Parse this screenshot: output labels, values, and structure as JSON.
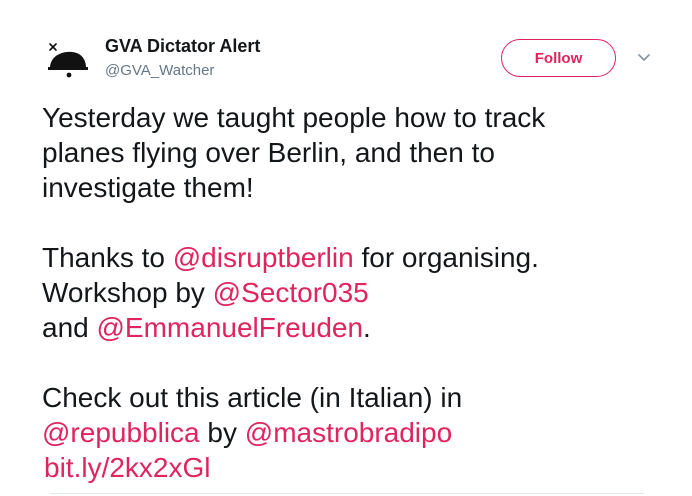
{
  "user": {
    "name": "GVA Dictator Alert",
    "handle": "@GVA_Watcher",
    "avatar_icon": "dictator-plane-avatar-icon"
  },
  "actions": {
    "follow_label": "Follow",
    "more_icon": "chevron-down-icon"
  },
  "colors": {
    "accent": "#e0245e",
    "text": "#14171a",
    "muted": "#657786"
  },
  "tweet": {
    "line1": "Yesterday we taught people how to track",
    "line2": "planes flying over Berlin, and then to",
    "line3": "investigate them!",
    "thanks_prefix": "Thanks to ",
    "mention_disrupt": "@disruptberlin",
    "thanks_suffix": " for organising.",
    "workshop_prefix": "Workshop by ",
    "mention_sector": "@Sector035",
    "and_prefix": "and ",
    "mention_emmanuel": "@EmmanuelFreuden",
    "and_suffix": ".",
    "checkout_text": "Check out this article (in Italian) in",
    "mention_repubblica": "@repubblica",
    "by_text": " by ",
    "mention_mastro": "@mastrobradipo",
    "link": "bit.ly/2kx2xGl"
  }
}
